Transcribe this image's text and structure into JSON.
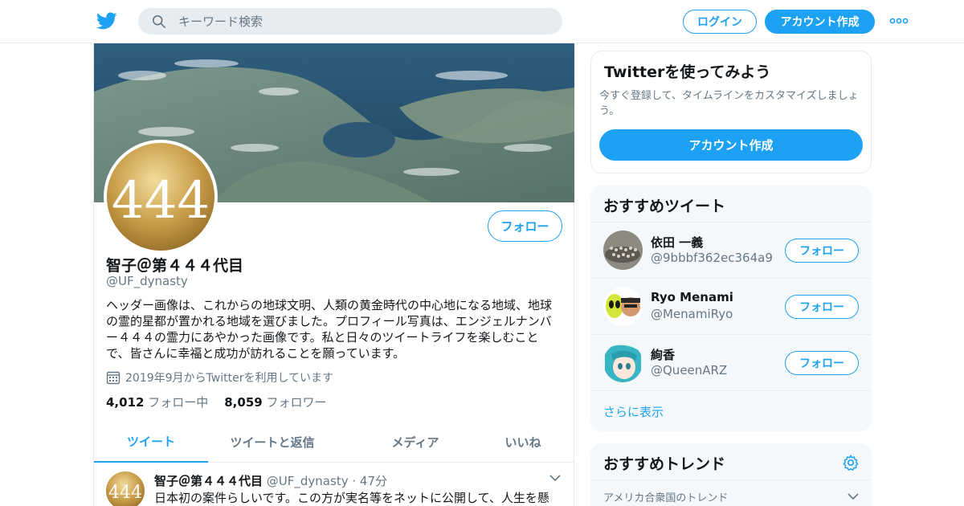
{
  "header": {
    "search_placeholder": "キーワード検索",
    "login_label": "ログイン",
    "signup_label": "アカウント作成"
  },
  "profile": {
    "avatar_text": "444",
    "follow_label": "フォロー",
    "name": "智子＠第４４４代目",
    "handle": "@UF_dynasty",
    "bio": "ヘッダー画像は、これからの地球文明、人類の黄金時代の中心地になる地域、地球の霊的星都が置かれる地域を選びました。プロフィール写真は、エンジェルナンバー４４４の霊力にあやかった画像です。私と日々のツイートライフを楽しむことで、皆さんに幸福と成功が訪れることを願っています。",
    "joined": "2019年9月からTwitterを利用しています",
    "following_count": "4,012",
    "following_label": "フォロー中",
    "followers_count": "8,059",
    "followers_label": "フォロワー"
  },
  "tabs": [
    {
      "label": "ツイート"
    },
    {
      "label": "ツイートと返信"
    },
    {
      "label": "メディア"
    },
    {
      "label": "いいね"
    }
  ],
  "tweet": {
    "name": "智子＠第４４４代目",
    "handle": "@UF_dynasty",
    "time": "· 47分",
    "text": "日本初の案件らしいです。この方が実名等をネットに公開して、人生を懸"
  },
  "signup_card": {
    "title": "Twitterを使ってみよう",
    "description": "今すぐ登録して、タイムラインをカスタマイズしましょう。",
    "button": "アカウント作成"
  },
  "recommended": {
    "title": "おすすめツイート",
    "users": [
      {
        "name": "依田 一義",
        "handle": "@9bbbf362ec364a9",
        "follow": "フォロー"
      },
      {
        "name": "Ryo Menami",
        "handle": "@MenamiRyo",
        "follow": "フォロー"
      },
      {
        "name": "絢香",
        "handle": "@QueenARZ",
        "follow": "フォロー"
      }
    ],
    "show_more": "さらに表示"
  },
  "trends": {
    "title": "おすすめトレンド",
    "subtitle": "アメリカ合衆国のトレンド"
  },
  "colors": {
    "accent": "#1da1f2",
    "text": "#14171a",
    "muted": "#657786",
    "panel": "#f5f8fa",
    "border": "#e6ecf0"
  }
}
